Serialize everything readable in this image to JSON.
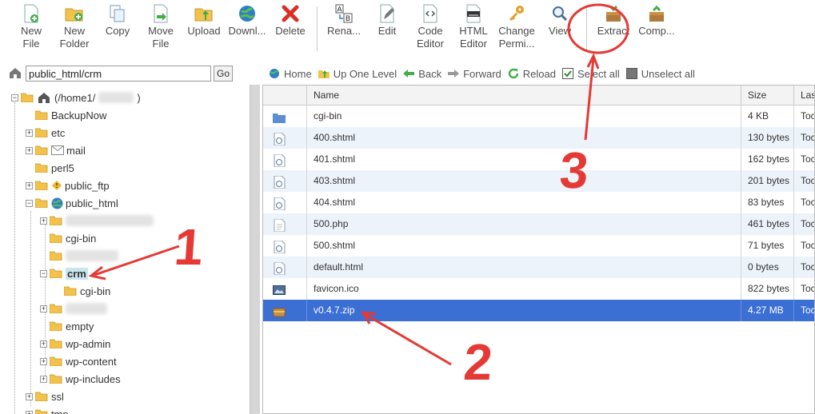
{
  "toolbar": {
    "buttons": [
      {
        "label": "New\nFile",
        "icon": "new-file-icon"
      },
      {
        "label": "New\nFolder",
        "icon": "new-folder-icon"
      },
      {
        "label": "Copy",
        "icon": "copy-icon"
      },
      {
        "label": "Move\nFile",
        "icon": "move-file-icon"
      },
      {
        "label": "Upload",
        "icon": "upload-icon"
      },
      {
        "label": "Downl...",
        "icon": "download-icon"
      },
      {
        "label": "Delete",
        "icon": "delete-icon"
      },
      {
        "label": "Rena...",
        "icon": "rename-icon"
      },
      {
        "label": "Edit",
        "icon": "edit-icon"
      },
      {
        "label": "Code\nEditor",
        "icon": "code-editor-icon"
      },
      {
        "label": "HTML\nEditor",
        "icon": "html-editor-icon"
      },
      {
        "label": "Change\nPermi...",
        "icon": "permissions-icon"
      },
      {
        "label": "View",
        "icon": "view-icon"
      },
      {
        "label": "Extract",
        "icon": "extract-icon"
      },
      {
        "label": "Comp...",
        "icon": "compress-icon"
      }
    ]
  },
  "pathbar": {
    "value": "public_html/crm",
    "go_label": "Go"
  },
  "tree": {
    "root_label": "(/home1/",
    "root_suffix": ")",
    "items": [
      {
        "label": "BackupNow"
      },
      {
        "label": "etc"
      },
      {
        "label": "mail"
      },
      {
        "label": "perl5"
      },
      {
        "label": "public_ftp"
      },
      {
        "label": "public_html"
      },
      {
        "label": ""
      },
      {
        "label": "cgi-bin"
      },
      {
        "label": ""
      },
      {
        "label": "crm"
      },
      {
        "label": "cgi-bin"
      },
      {
        "label": ""
      },
      {
        "label": "empty"
      },
      {
        "label": "wp-admin"
      },
      {
        "label": "wp-content"
      },
      {
        "label": "wp-includes"
      },
      {
        "label": "ssl"
      },
      {
        "label": "tmp"
      }
    ]
  },
  "navbar": {
    "home": "Home",
    "up": "Up One Level",
    "back": "Back",
    "forward": "Forward",
    "reload": "Reload",
    "select_all": "Select all",
    "unselect_all": "Unselect all"
  },
  "table": {
    "headers": {
      "name": "Name",
      "size": "Size",
      "last": "Las"
    },
    "rows": [
      {
        "name": "cgi-bin",
        "size": "4 KB",
        "modified": "Toc",
        "icon": "folder-icon"
      },
      {
        "name": "400.shtml",
        "size": "130 bytes",
        "modified": "Toc",
        "icon": "web-file-icon"
      },
      {
        "name": "401.shtml",
        "size": "162 bytes",
        "modified": "Toc",
        "icon": "web-file-icon"
      },
      {
        "name": "403.shtml",
        "size": "201 bytes",
        "modified": "Toc",
        "icon": "web-file-icon"
      },
      {
        "name": "404.shtml",
        "size": "83 bytes",
        "modified": "Toc",
        "icon": "web-file-icon"
      },
      {
        "name": "500.php",
        "size": "461 bytes",
        "modified": "Toc",
        "icon": "text-file-icon"
      },
      {
        "name": "500.shtml",
        "size": "71 bytes",
        "modified": "Toc",
        "icon": "web-file-icon"
      },
      {
        "name": "default.html",
        "size": "0 bytes",
        "modified": "Toc",
        "icon": "web-file-icon"
      },
      {
        "name": "favicon.ico",
        "size": "822 bytes",
        "modified": "Toc",
        "icon": "image-file-icon"
      },
      {
        "name": "v0.4.7.zip",
        "size": "4.27 MB",
        "modified": "Toc",
        "icon": "archive-icon"
      }
    ]
  },
  "annotations": {
    "one": "1",
    "two": "2",
    "three": "3"
  },
  "colors": {
    "selected_row": "#3b6fd4",
    "annotation": "#e53935",
    "alt_row": "#edf3fb"
  }
}
